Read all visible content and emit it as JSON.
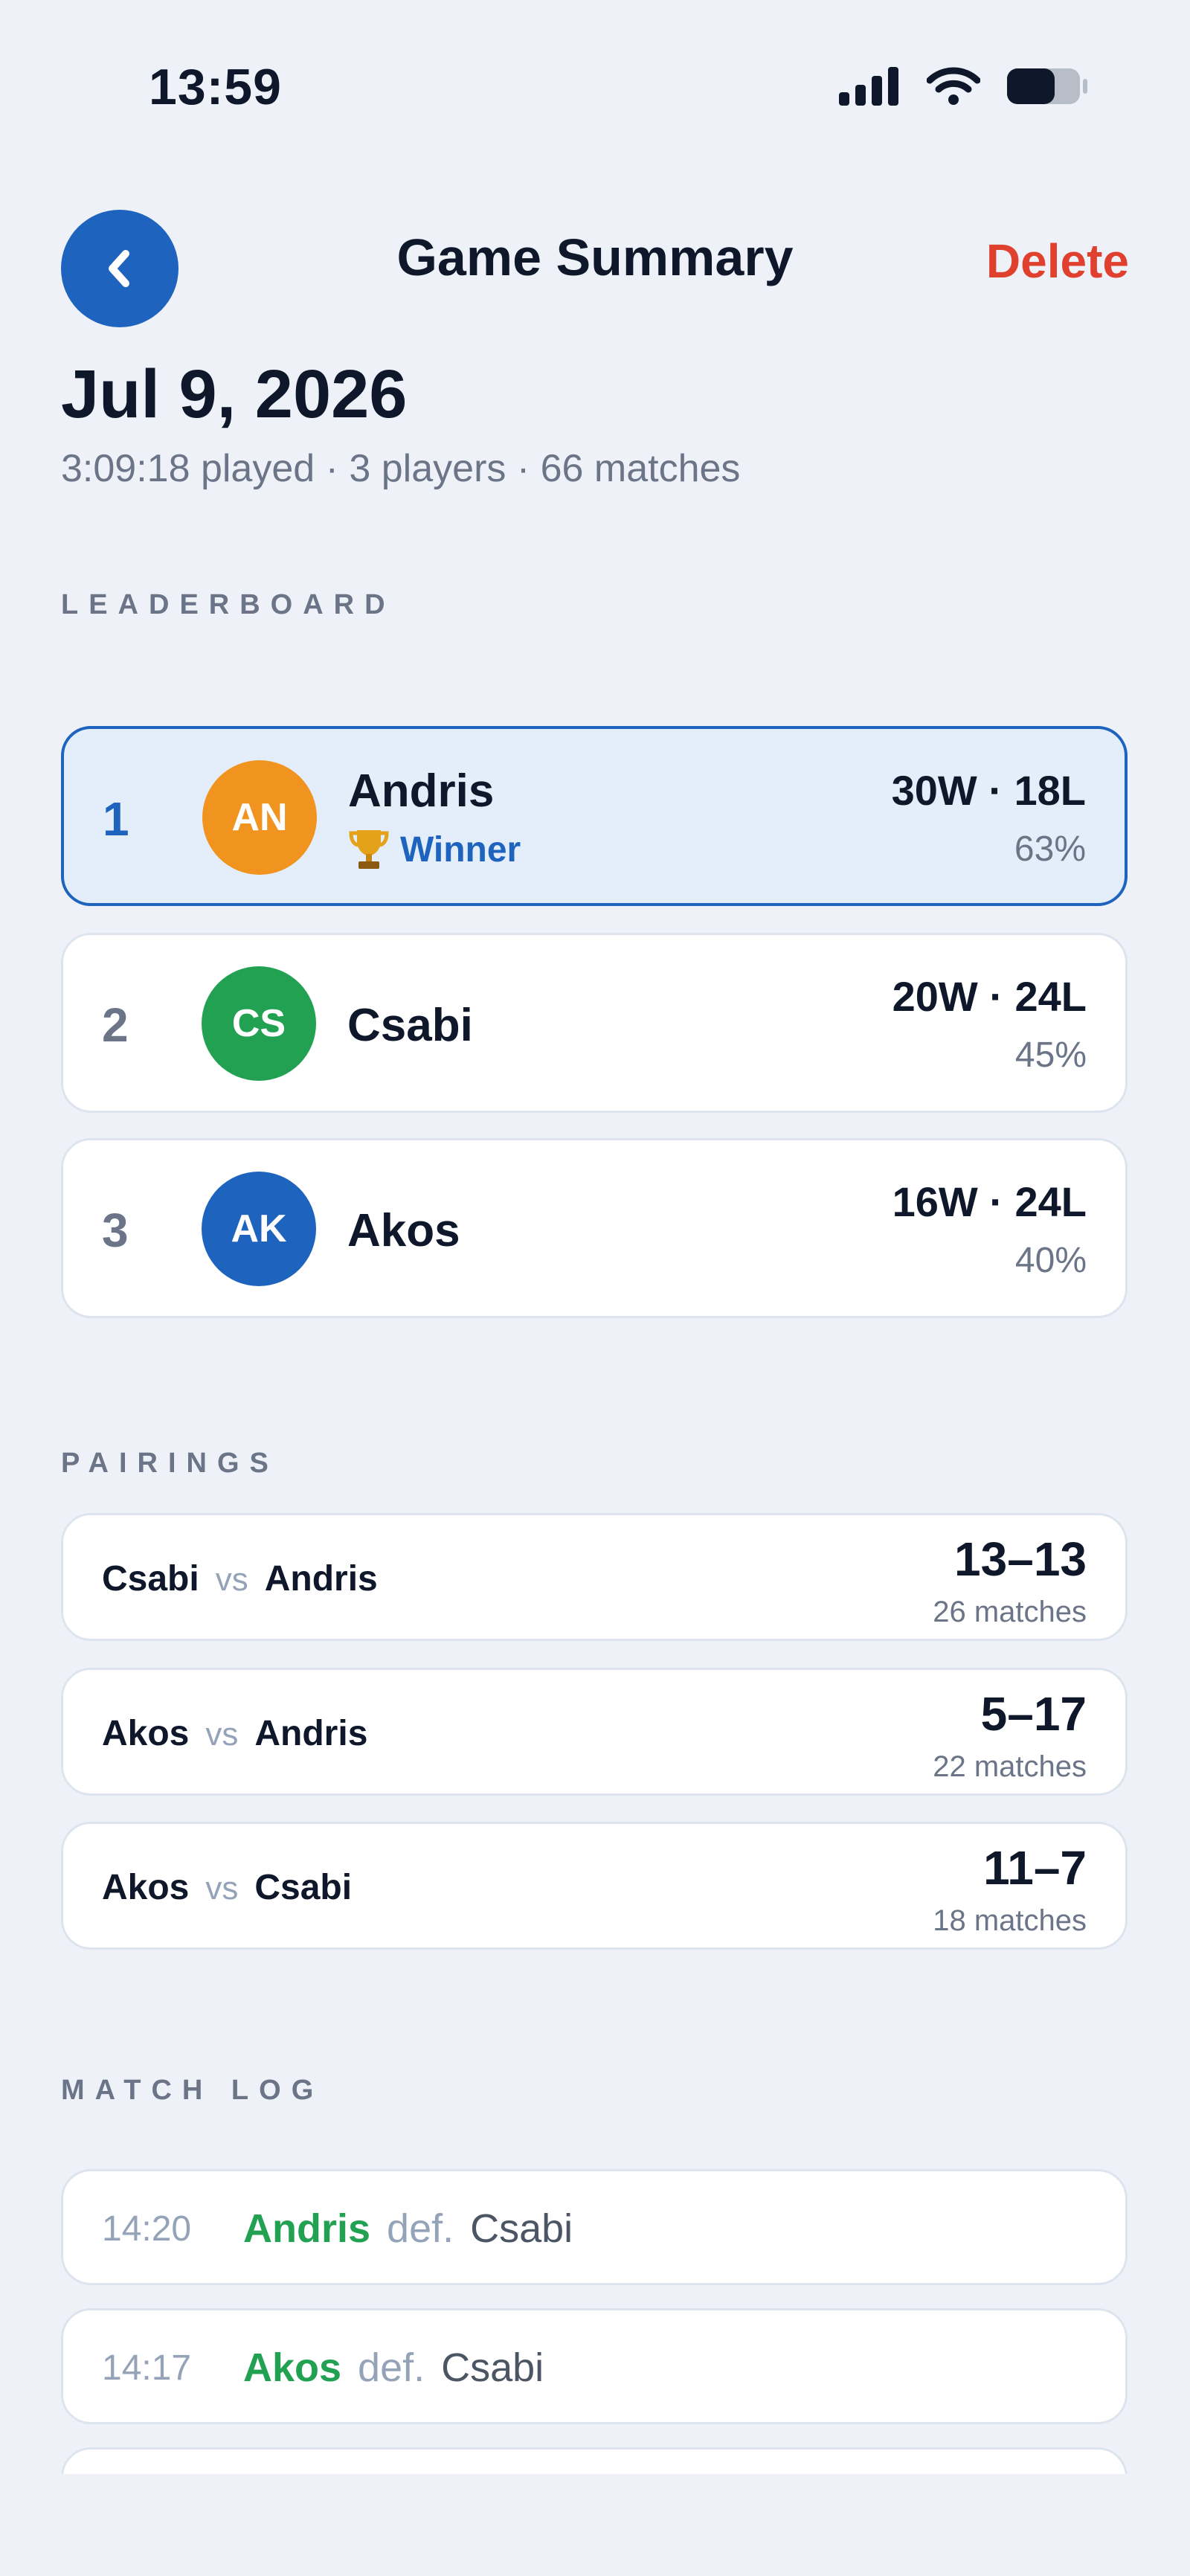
{
  "status_bar": {
    "time": "13:59"
  },
  "header": {
    "title": "Game Summary",
    "delete_label": "Delete"
  },
  "summary": {
    "date": "Jul 9, 2026",
    "subtitle": "3:09:18 played · 3 players · 66 matches"
  },
  "leaderboard": {
    "heading": "LEADERBOARD",
    "players": [
      {
        "rank": "1",
        "initials": "AN",
        "name": "Andris",
        "badge": "Winner",
        "record": "30W · 18L",
        "pct": "63%",
        "avatar_color": "#f0941f"
      },
      {
        "rank": "2",
        "initials": "CS",
        "name": "Csabi",
        "record": "20W · 24L",
        "pct": "45%",
        "avatar_color": "#22a152"
      },
      {
        "rank": "3",
        "initials": "AK",
        "name": "Akos",
        "record": "16W · 24L",
        "pct": "40%",
        "avatar_color": "#1e63be"
      }
    ]
  },
  "pairings": {
    "heading": "PAIRINGS",
    "vs_label": "vs",
    "items": [
      {
        "a": "Csabi",
        "b": "Andris",
        "score": "13–13",
        "matches": "26 matches"
      },
      {
        "a": "Akos",
        "b": "Andris",
        "score": "5–17",
        "matches": "22 matches"
      },
      {
        "a": "Akos",
        "b": "Csabi",
        "score": "11–7",
        "matches": "18 matches"
      }
    ]
  },
  "match_log": {
    "heading": "MATCH LOG",
    "def_label": "def.",
    "items": [
      {
        "time": "14:20",
        "winner": "Andris",
        "loser": "Csabi"
      },
      {
        "time": "14:17",
        "winner": "Akos",
        "loser": "Csabi"
      }
    ]
  },
  "colors": {
    "accent": "#1e63be",
    "danger": "#e0412f",
    "win_green": "#22a152",
    "background": "#eef2f8"
  }
}
